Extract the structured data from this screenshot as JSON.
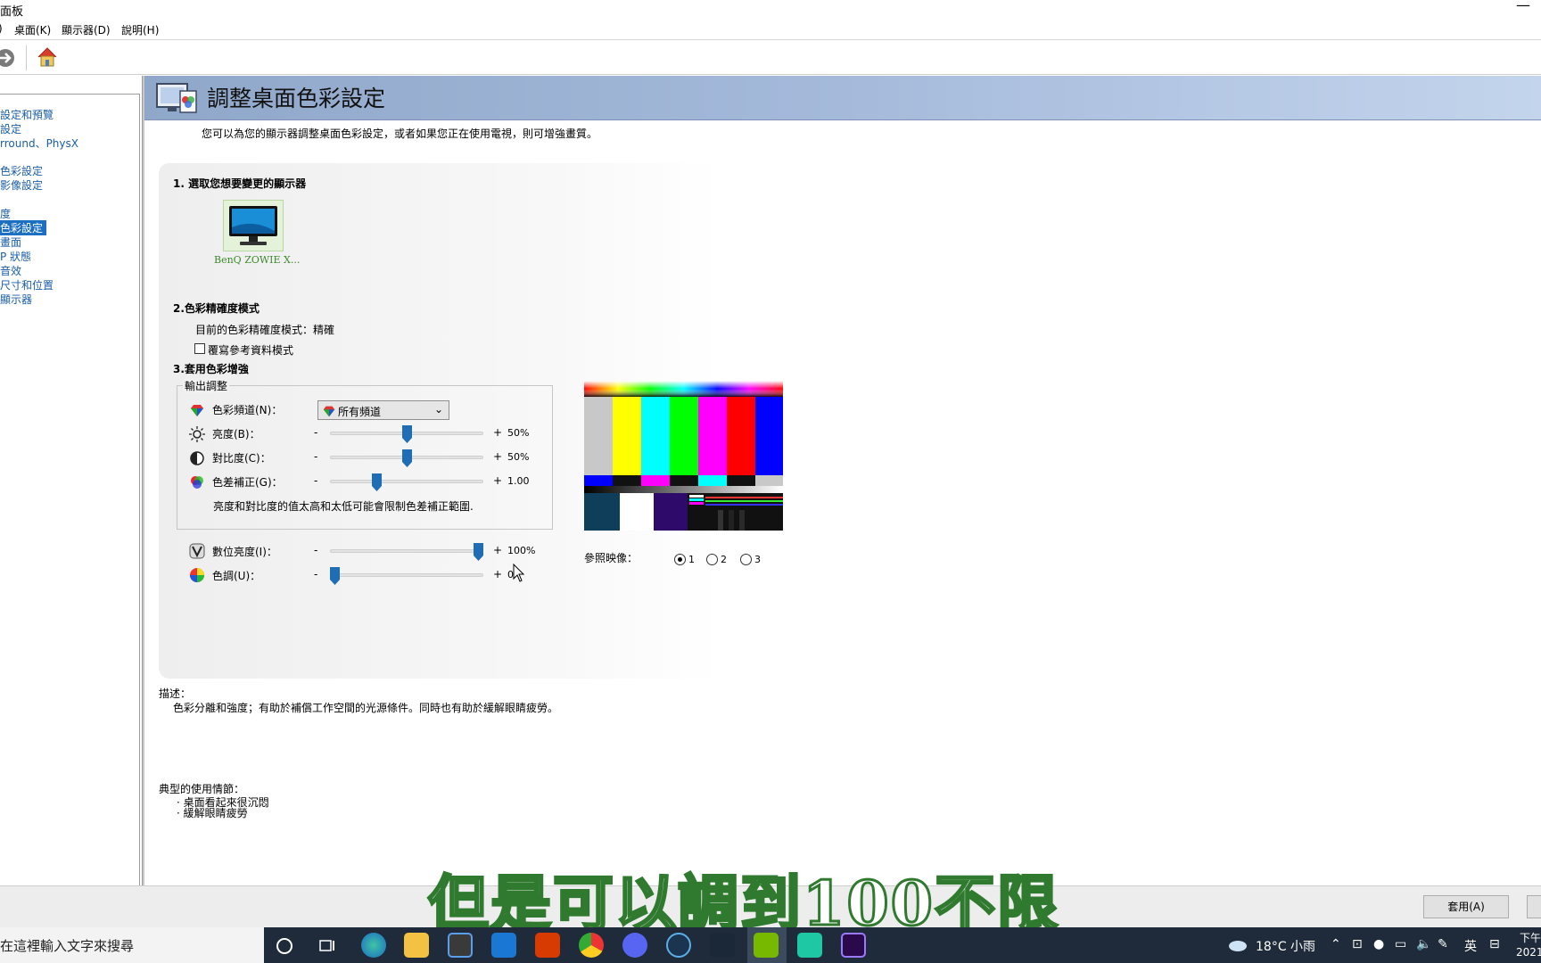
{
  "window": {
    "title": "面板",
    "minimize": "—"
  },
  "menu": [
    {
      "label": "桌面(K)"
    },
    {
      "label": "顯示器(D)"
    },
    {
      "label": "說明(H)"
    }
  ],
  "nav": [
    {
      "label": "設定和預覽"
    },
    {
      "label": "設定"
    },
    {
      "label": "rround、PhysX"
    },
    {
      "label": "色彩設定"
    },
    {
      "label": "影像設定"
    },
    {
      "label": "度"
    },
    {
      "label": "色彩設定",
      "selected": true
    },
    {
      "label": "畫面"
    },
    {
      "label": "P 狀態"
    },
    {
      "label": "音效"
    },
    {
      "label": "尺寸和位置"
    },
    {
      "label": "顯示器"
    }
  ],
  "header": {
    "title": "調整桌面色彩設定"
  },
  "intro": "您可以為您的顯示器調整桌面色彩設定，或者如果您正在使用電視，則可增強畫質。",
  "section1": {
    "title": "1. 選取您想要變更的顯示器",
    "monitor_label": "BenQ ZOWIE X..."
  },
  "section2": {
    "title": "2.色彩精確度模式",
    "current": "目前的色彩精確度模式：精確",
    "override_label": "覆寫參考資料模式",
    "override_checked": false
  },
  "section3": {
    "title": "3.套用色彩增強",
    "group_label": "輸出調整",
    "channel_label": "色彩頻道(N)：",
    "channel_value": "所有頻道",
    "sliders": [
      {
        "label": "亮度(B)：",
        "value": "50%",
        "level": 0.5
      },
      {
        "label": "對比度(C)：",
        "value": "50%",
        "level": 0.5
      },
      {
        "label": "色差補正(G)：",
        "value": "1.00",
        "level": 0.29
      }
    ],
    "note": "亮度和對比度的值太高和太低可能會限制色差補正範圍.",
    "extra_sliders": [
      {
        "label": "數位亮度(I)：",
        "value": "100%",
        "level": 1.0
      },
      {
        "label": "色調(U)：",
        "value": "0",
        "level": 0.0
      }
    ],
    "minus": "-",
    "plus": "+"
  },
  "reference": {
    "label": "參照映像：",
    "options": [
      {
        "label": "1",
        "selected": true
      },
      {
        "label": "2",
        "selected": false
      },
      {
        "label": "3",
        "selected": false
      }
    ]
  },
  "description": {
    "heading": "描述：",
    "text": "色彩分離和強度；有助於補償工作空間的光源條件。同時也有助於緩解眼睛疲勞。"
  },
  "usage": {
    "heading": "典型的使用情節：",
    "items": [
      "桌面看起來很沉悶",
      "緩解眼睛疲勞"
    ]
  },
  "footer": {
    "apply": "套用(A)"
  },
  "subtitle": "但是可以調到100不限",
  "taskbar": {
    "search": "在這裡輸入文字來搜尋",
    "weather": "18°C 小雨",
    "ime": "英",
    "clock_time": "下午",
    "clock_date": "2021"
  },
  "colors": {
    "header": "#a5badb",
    "selected_nav": "#1c6fc2",
    "slider_thumb": "#1f6db5",
    "subtitle_stroke": "#2f7a2f",
    "taskbar": "#1f2b3a"
  }
}
